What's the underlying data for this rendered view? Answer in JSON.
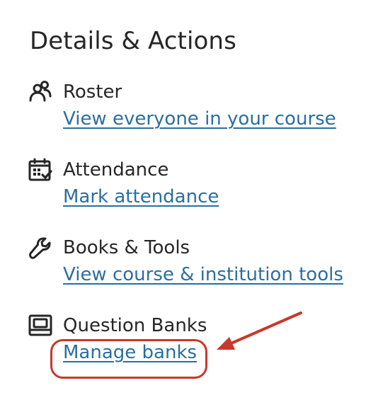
{
  "panel": {
    "title": "Details & Actions",
    "sections": [
      {
        "icon": "people-icon",
        "label": "Roster",
        "link": "View everyone in your course"
      },
      {
        "icon": "calendar-check-icon",
        "label": "Attendance",
        "link": "Mark attendance"
      },
      {
        "icon": "wrench-icon",
        "label": "Books & Tools",
        "link": "View course & institution tools"
      },
      {
        "icon": "question-bank-icon",
        "label": "Question Banks",
        "link": "Manage banks"
      }
    ]
  },
  "annotation": {
    "color": "#c9382a",
    "highlights": "Manage banks"
  },
  "colors": {
    "text": "#262626",
    "link": "#2b6ea0"
  }
}
